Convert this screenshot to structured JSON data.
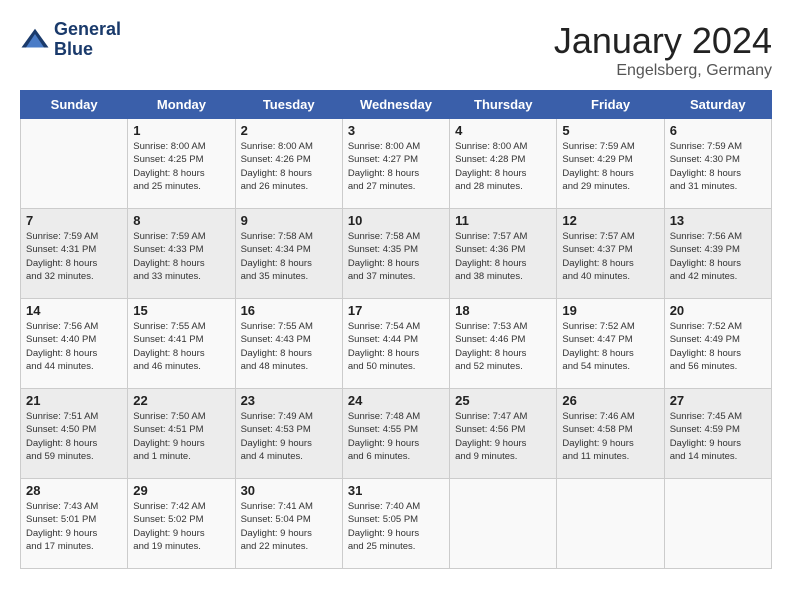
{
  "header": {
    "logo_line1": "General",
    "logo_line2": "Blue",
    "month_title": "January 2024",
    "location": "Engelsberg, Germany"
  },
  "days_of_week": [
    "Sunday",
    "Monday",
    "Tuesday",
    "Wednesday",
    "Thursday",
    "Friday",
    "Saturday"
  ],
  "weeks": [
    [
      {
        "day": "",
        "info": ""
      },
      {
        "day": "1",
        "info": "Sunrise: 8:00 AM\nSunset: 4:25 PM\nDaylight: 8 hours\nand 25 minutes."
      },
      {
        "day": "2",
        "info": "Sunrise: 8:00 AM\nSunset: 4:26 PM\nDaylight: 8 hours\nand 26 minutes."
      },
      {
        "day": "3",
        "info": "Sunrise: 8:00 AM\nSunset: 4:27 PM\nDaylight: 8 hours\nand 27 minutes."
      },
      {
        "day": "4",
        "info": "Sunrise: 8:00 AM\nSunset: 4:28 PM\nDaylight: 8 hours\nand 28 minutes."
      },
      {
        "day": "5",
        "info": "Sunrise: 7:59 AM\nSunset: 4:29 PM\nDaylight: 8 hours\nand 29 minutes."
      },
      {
        "day": "6",
        "info": "Sunrise: 7:59 AM\nSunset: 4:30 PM\nDaylight: 8 hours\nand 31 minutes."
      }
    ],
    [
      {
        "day": "7",
        "info": "Sunrise: 7:59 AM\nSunset: 4:31 PM\nDaylight: 8 hours\nand 32 minutes."
      },
      {
        "day": "8",
        "info": "Sunrise: 7:59 AM\nSunset: 4:33 PM\nDaylight: 8 hours\nand 33 minutes."
      },
      {
        "day": "9",
        "info": "Sunrise: 7:58 AM\nSunset: 4:34 PM\nDaylight: 8 hours\nand 35 minutes."
      },
      {
        "day": "10",
        "info": "Sunrise: 7:58 AM\nSunset: 4:35 PM\nDaylight: 8 hours\nand 37 minutes."
      },
      {
        "day": "11",
        "info": "Sunrise: 7:57 AM\nSunset: 4:36 PM\nDaylight: 8 hours\nand 38 minutes."
      },
      {
        "day": "12",
        "info": "Sunrise: 7:57 AM\nSunset: 4:37 PM\nDaylight: 8 hours\nand 40 minutes."
      },
      {
        "day": "13",
        "info": "Sunrise: 7:56 AM\nSunset: 4:39 PM\nDaylight: 8 hours\nand 42 minutes."
      }
    ],
    [
      {
        "day": "14",
        "info": "Sunrise: 7:56 AM\nSunset: 4:40 PM\nDaylight: 8 hours\nand 44 minutes."
      },
      {
        "day": "15",
        "info": "Sunrise: 7:55 AM\nSunset: 4:41 PM\nDaylight: 8 hours\nand 46 minutes."
      },
      {
        "day": "16",
        "info": "Sunrise: 7:55 AM\nSunset: 4:43 PM\nDaylight: 8 hours\nand 48 minutes."
      },
      {
        "day": "17",
        "info": "Sunrise: 7:54 AM\nSunset: 4:44 PM\nDaylight: 8 hours\nand 50 minutes."
      },
      {
        "day": "18",
        "info": "Sunrise: 7:53 AM\nSunset: 4:46 PM\nDaylight: 8 hours\nand 52 minutes."
      },
      {
        "day": "19",
        "info": "Sunrise: 7:52 AM\nSunset: 4:47 PM\nDaylight: 8 hours\nand 54 minutes."
      },
      {
        "day": "20",
        "info": "Sunrise: 7:52 AM\nSunset: 4:49 PM\nDaylight: 8 hours\nand 56 minutes."
      }
    ],
    [
      {
        "day": "21",
        "info": "Sunrise: 7:51 AM\nSunset: 4:50 PM\nDaylight: 8 hours\nand 59 minutes."
      },
      {
        "day": "22",
        "info": "Sunrise: 7:50 AM\nSunset: 4:51 PM\nDaylight: 9 hours\nand 1 minute."
      },
      {
        "day": "23",
        "info": "Sunrise: 7:49 AM\nSunset: 4:53 PM\nDaylight: 9 hours\nand 4 minutes."
      },
      {
        "day": "24",
        "info": "Sunrise: 7:48 AM\nSunset: 4:55 PM\nDaylight: 9 hours\nand 6 minutes."
      },
      {
        "day": "25",
        "info": "Sunrise: 7:47 AM\nSunset: 4:56 PM\nDaylight: 9 hours\nand 9 minutes."
      },
      {
        "day": "26",
        "info": "Sunrise: 7:46 AM\nSunset: 4:58 PM\nDaylight: 9 hours\nand 11 minutes."
      },
      {
        "day": "27",
        "info": "Sunrise: 7:45 AM\nSunset: 4:59 PM\nDaylight: 9 hours\nand 14 minutes."
      }
    ],
    [
      {
        "day": "28",
        "info": "Sunrise: 7:43 AM\nSunset: 5:01 PM\nDaylight: 9 hours\nand 17 minutes."
      },
      {
        "day": "29",
        "info": "Sunrise: 7:42 AM\nSunset: 5:02 PM\nDaylight: 9 hours\nand 19 minutes."
      },
      {
        "day": "30",
        "info": "Sunrise: 7:41 AM\nSunset: 5:04 PM\nDaylight: 9 hours\nand 22 minutes."
      },
      {
        "day": "31",
        "info": "Sunrise: 7:40 AM\nSunset: 5:05 PM\nDaylight: 9 hours\nand 25 minutes."
      },
      {
        "day": "",
        "info": ""
      },
      {
        "day": "",
        "info": ""
      },
      {
        "day": "",
        "info": ""
      }
    ]
  ]
}
